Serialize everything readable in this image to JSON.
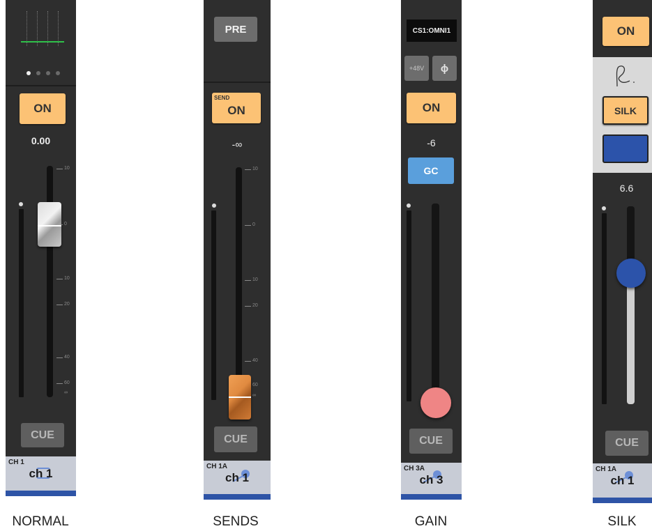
{
  "strips": {
    "normal": {
      "on_label": "ON",
      "value": "0.00",
      "scale": [
        "10",
        "0",
        "10",
        "20",
        "40",
        "60",
        "∞"
      ],
      "cue_label": "CUE",
      "channel_number": "CH 1",
      "channel_name": "ch 1",
      "caption": "NORMAL"
    },
    "sends": {
      "pre_label": "PRE",
      "send_tag": "SEND",
      "on_label": "ON",
      "value": "-∞",
      "scale": [
        "10",
        "0",
        "10",
        "20",
        "40",
        "60",
        "∞"
      ],
      "cue_label": "CUE",
      "channel_number": "CH 1A",
      "channel_name": "ch 1",
      "caption": "SENDS"
    },
    "gain": {
      "input_patch": "CS1:OMNI1",
      "phantom_label": "+48V",
      "phase_label": "ϕ",
      "on_label": "ON",
      "value": "-6",
      "gc_label": "GC",
      "cue_label": "CUE",
      "channel_number": "CH 3A",
      "channel_name": "ch 3",
      "caption": "GAIN"
    },
    "silk": {
      "on_label": "ON",
      "silk_label": "SILK",
      "value": "6.6",
      "cue_label": "CUE",
      "channel_number": "CH 1A",
      "channel_name": "ch 1",
      "caption": "SILK"
    }
  },
  "colors": {
    "on_button": "#fcc275",
    "gc_button": "#5a9fdc",
    "gain_knob": "#ef8585",
    "silk_knob": "#2c53aa",
    "label_bar": "#2e54a6",
    "sends_fader": "#d9803a"
  }
}
